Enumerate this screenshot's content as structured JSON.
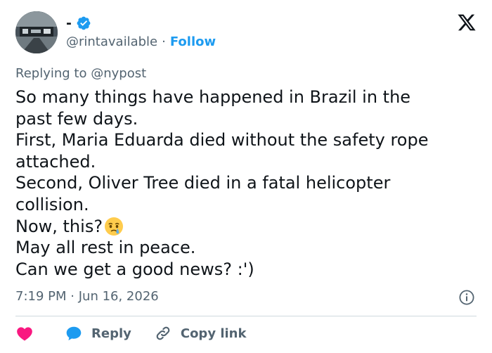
{
  "author": {
    "display_name": "-",
    "handle": "@rintavailable",
    "separator": "·",
    "follow_label": "Follow",
    "verified": true,
    "verified_color": "#1d9bf0"
  },
  "reply_context": {
    "prefix": "Replying to",
    "mention": "@nypost"
  },
  "tweet": {
    "lines": [
      "So many things have happened in Brazil in the",
      "past few days.",
      "First, Maria Eduarda died without the safety rope",
      "attached.",
      "Second, Oliver Tree died in a fatal helicopter",
      "collision.",
      "Now, this?",
      "May all rest in peace.",
      "Can we get a good news? :')"
    ],
    "inline_emoji": "face-holding-back-tears"
  },
  "meta": {
    "time": "7:19 PM",
    "separator": "·",
    "date": "Jun 16, 2026"
  },
  "actions": {
    "like_icon": "heart-icon",
    "reply_label": "Reply",
    "copy_link_label": "Copy link"
  },
  "icons": {
    "brand": "x-logo-icon",
    "info": "info-icon"
  },
  "colors": {
    "text": "#0f1419",
    "secondary": "#536471",
    "accent": "#1d9bf0",
    "like": "#f91880",
    "divider": "#cfd9de"
  }
}
